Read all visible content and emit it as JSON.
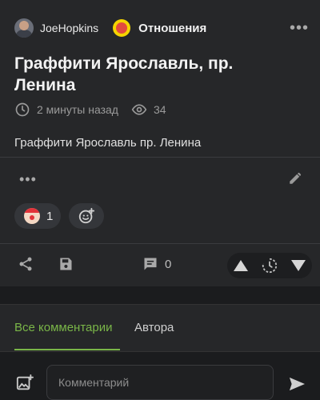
{
  "post": {
    "author": "JoeHopkins",
    "community": "Отношения",
    "title": "Граффити Ярославль, пр. Ленина",
    "time_ago": "2 минуты назад",
    "views": "34",
    "body": "Граффити Ярославль пр. Ленина",
    "reaction_count": "1",
    "comments_count": "0"
  },
  "tabs": {
    "all_comments": "Все комментарии",
    "author": "Автора"
  },
  "composer": {
    "placeholder": "Комментарий"
  },
  "icons": {
    "clock": "clock-icon",
    "views": "eye-icon",
    "edit": "pencil-icon",
    "share": "share-icon",
    "save": "save-icon",
    "comment": "comment-icon",
    "upvote": "triangle-up-icon",
    "downvote": "triangle-down-icon",
    "add_reaction": "smiley-plus-icon",
    "attach_image": "image-plus-icon",
    "send": "send-icon"
  },
  "colors": {
    "accent": "#7ab648",
    "background": "#1b1c1e",
    "card": "#262729"
  }
}
